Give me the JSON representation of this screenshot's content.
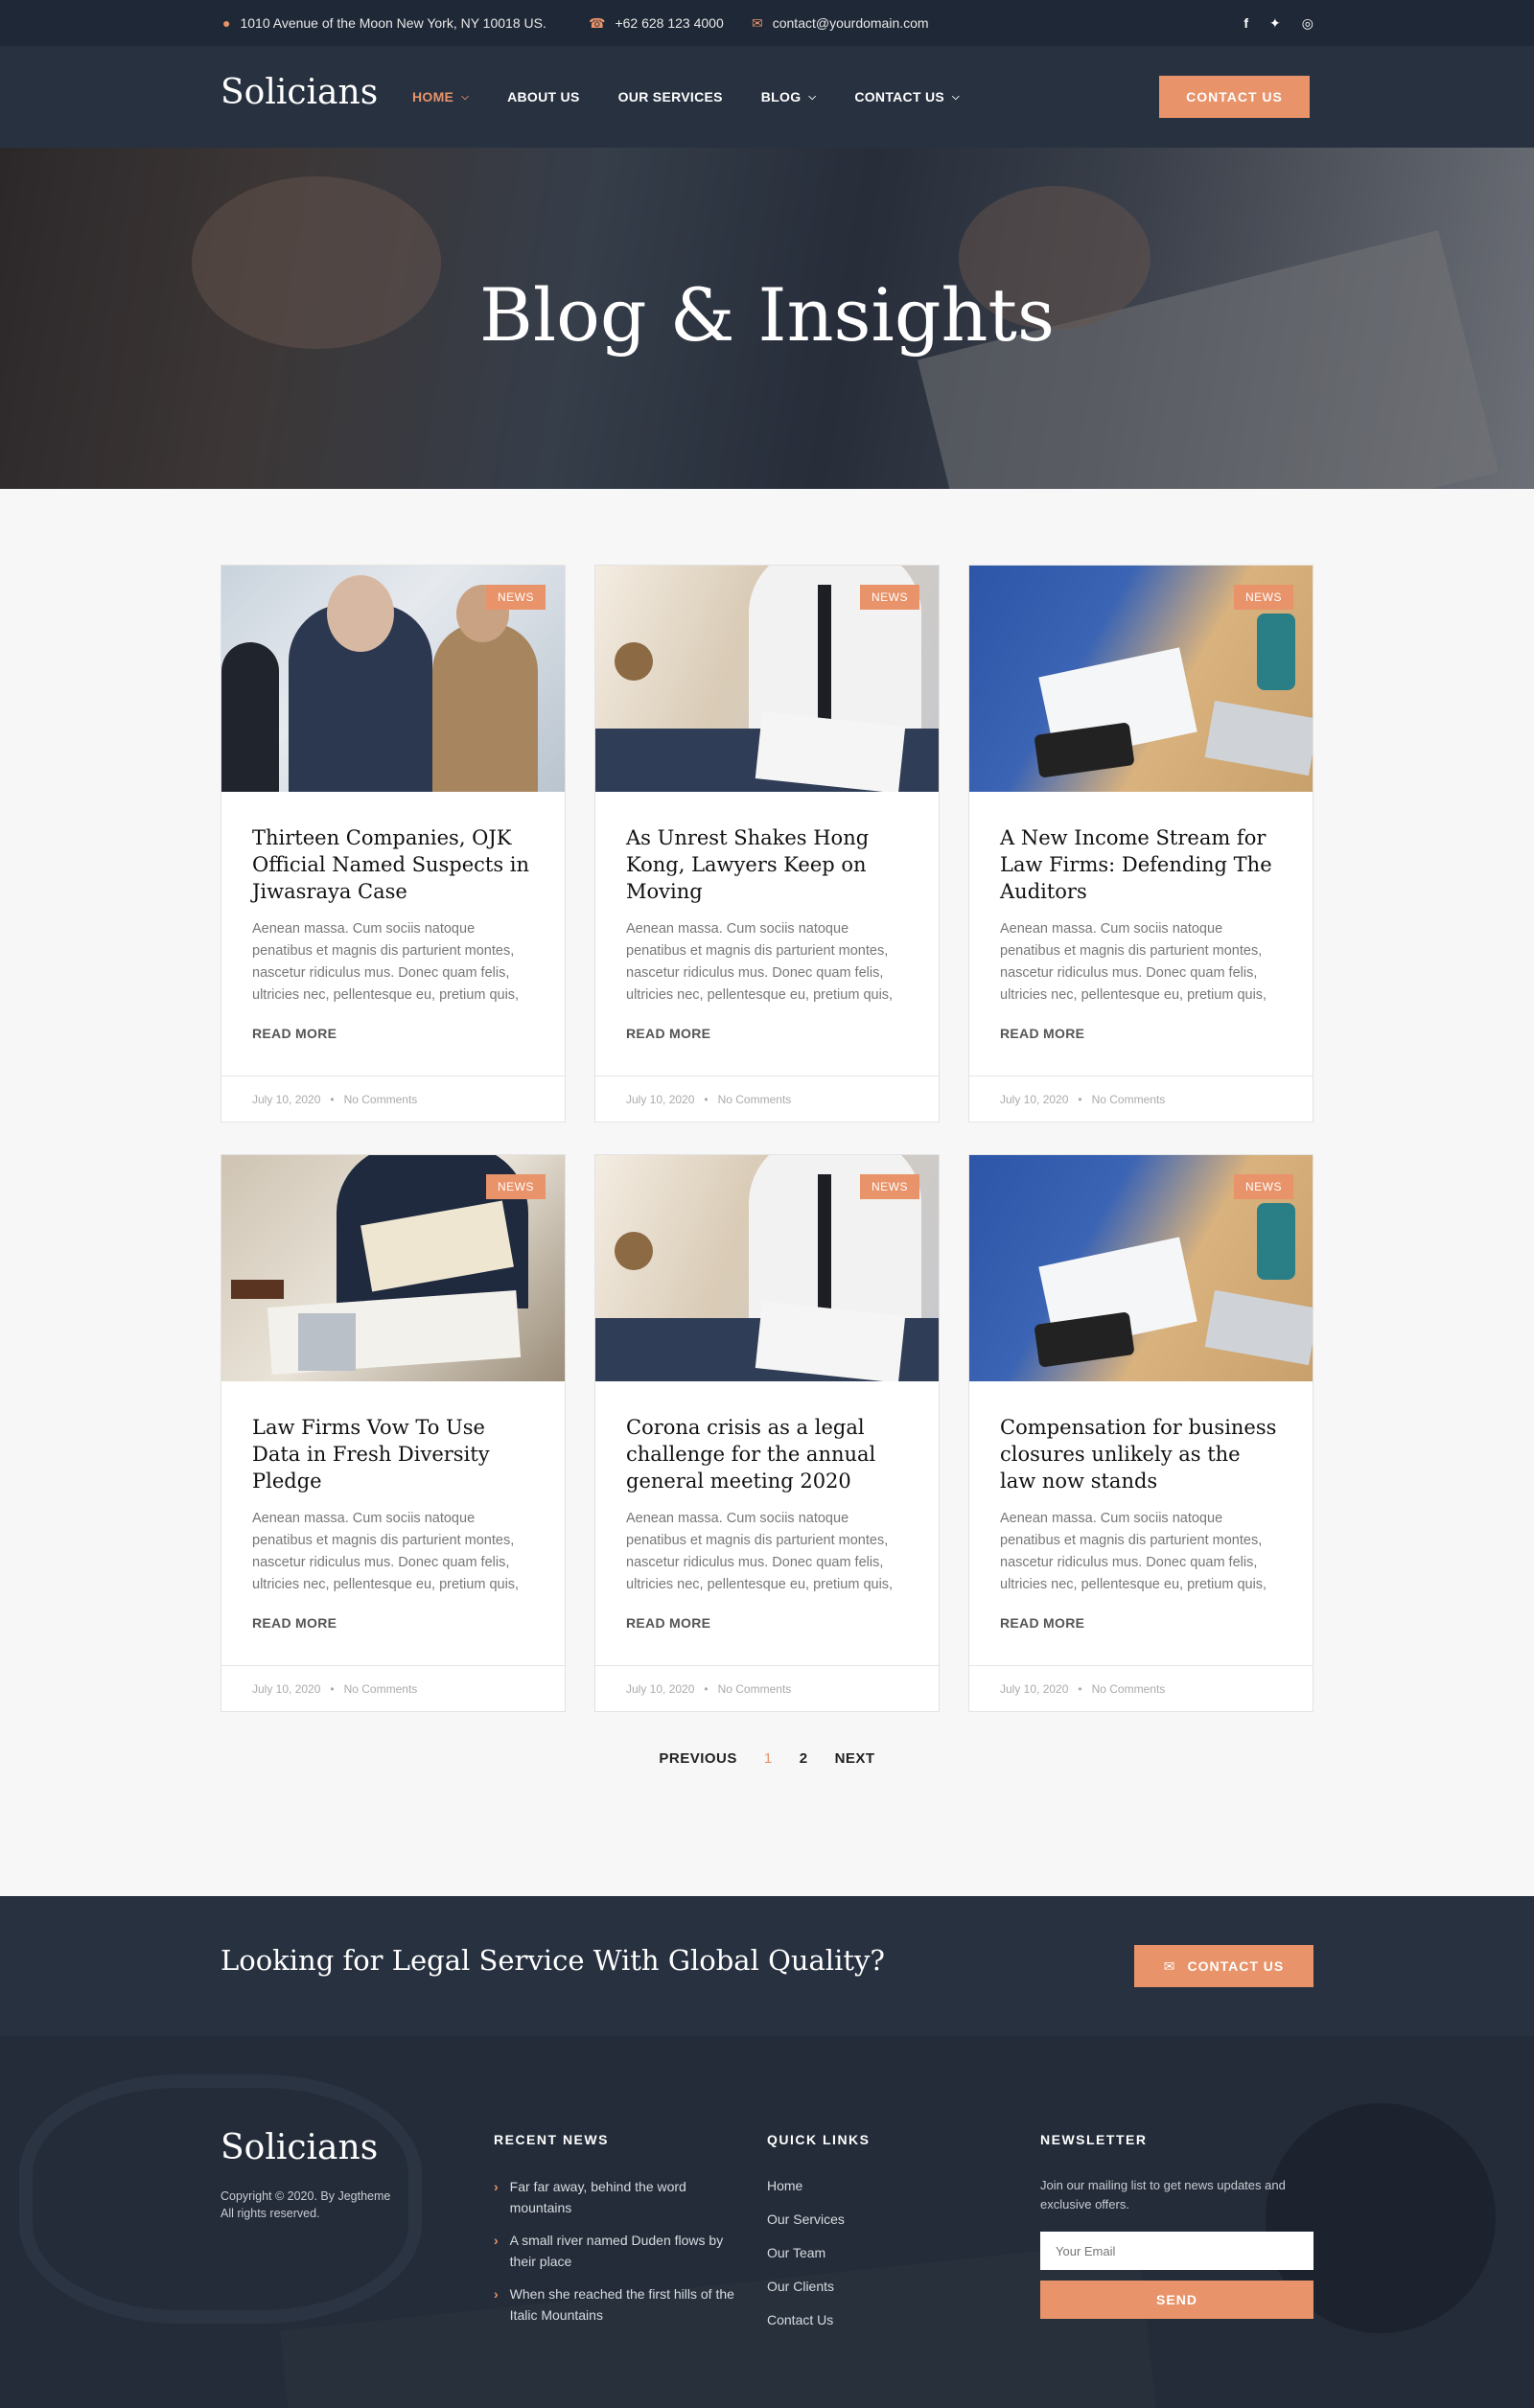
{
  "topbar": {
    "address": "1010 Avenue of the Moon New York, NY 10018 US.",
    "phone": "+62 628 123 4000",
    "email": "contact@yourdomain.com",
    "address_icon": "map-pin-icon",
    "phone_icon": "phone-icon",
    "email_icon": "envelope-icon",
    "socials": [
      "facebook-icon",
      "twitter-icon",
      "instagram-icon"
    ]
  },
  "nav": {
    "logo": "Solicians",
    "items": [
      {
        "label": "HOME",
        "dropdown": true,
        "active": true
      },
      {
        "label": "ABOUT US",
        "dropdown": false
      },
      {
        "label": "OUR SERVICES",
        "dropdown": false
      },
      {
        "label": "BLOG",
        "dropdown": true
      },
      {
        "label": "CONTACT US",
        "dropdown": true
      }
    ],
    "cta": "CONTACT US"
  },
  "hero": {
    "title": "Blog & Insights"
  },
  "posts": [
    {
      "badge": "NEWS",
      "title": "Thirteen Companies, OJK Official Named Suspects in Jiwasraya Case",
      "excerpt": "Aenean massa. Cum sociis natoque penatibus et magnis dis parturient montes, nascetur ridiculus mus. Donec quam felis, ultricies nec, pellentesque eu, pretium quis,",
      "more": "READ MORE",
      "date": "July 10, 2020",
      "dot": "•",
      "comments": "No Comments"
    },
    {
      "badge": "NEWS",
      "title": "As Unrest Shakes Hong Kong, Lawyers Keep on Moving",
      "excerpt": "Aenean massa. Cum sociis natoque penatibus et magnis dis parturient montes, nascetur ridiculus mus. Donec quam felis, ultricies nec, pellentesque eu, pretium quis,",
      "more": "READ MORE",
      "date": "July 10, 2020",
      "dot": "•",
      "comments": "No Comments"
    },
    {
      "badge": "NEWS",
      "title": "A New Income Stream for Law Firms: Defending The Auditors",
      "excerpt": "Aenean massa. Cum sociis natoque penatibus et magnis dis parturient montes, nascetur ridiculus mus. Donec quam felis, ultricies nec, pellentesque eu, pretium quis,",
      "more": "READ MORE",
      "date": "July 10, 2020",
      "dot": "•",
      "comments": "No Comments"
    },
    {
      "badge": "NEWS",
      "title": "Law Firms Vow To Use Data in Fresh Diversity Pledge",
      "excerpt": "Aenean massa. Cum sociis natoque penatibus et magnis dis parturient montes, nascetur ridiculus mus. Donec quam felis, ultricies nec, pellentesque eu, pretium quis,",
      "more": "READ MORE",
      "date": "July 10, 2020",
      "dot": "•",
      "comments": "No Comments"
    },
    {
      "badge": "NEWS",
      "title": "Corona crisis as a legal challenge for the annual general meeting 2020",
      "excerpt": "Aenean massa. Cum sociis natoque penatibus et magnis dis parturient montes, nascetur ridiculus mus. Donec quam felis, ultricies nec, pellentesque eu, pretium quis,",
      "more": "READ MORE",
      "date": "July 10, 2020",
      "dot": "•",
      "comments": "No Comments"
    },
    {
      "badge": "NEWS",
      "title": "Compensation for business closures unlikely as the law now stands",
      "excerpt": "Aenean massa. Cum sociis natoque penatibus et magnis dis parturient montes, nascetur ridiculus mus. Donec quam felis, ultricies nec, pellentesque eu, pretium quis,",
      "more": "READ MORE",
      "date": "July 10, 2020",
      "dot": "•",
      "comments": "No Comments"
    }
  ],
  "pagination": {
    "previous": "PREVIOUS",
    "pages": [
      "1",
      "2"
    ],
    "current": "1",
    "next": "NEXT"
  },
  "cta_band": {
    "heading": "Looking for Legal Service With Global Quality?",
    "button": "CONTACT US",
    "button_icon": "envelope-icon"
  },
  "footer": {
    "logo": "Solicians",
    "copyright": "Copyright © 2020. By Jegtheme",
    "rights": "All rights reserved.",
    "recent_news": {
      "title": "RECENT NEWS",
      "items": [
        "Far far away, behind the word mountains",
        "A small river named Duden flows by their place",
        "When she reached the first hills of the Italic Mountains"
      ]
    },
    "quick_links": {
      "title": "QUICK LINKS",
      "items": [
        "Home",
        "Our Services",
        "Our Team",
        "Our Clients",
        "Contact Us"
      ]
    },
    "newsletter": {
      "title": "NEWSLETTER",
      "text": "Join our mailing list to get news updates and exclusive offers.",
      "placeholder": "Your Email",
      "button": "SEND"
    }
  },
  "colors": {
    "accent": "#e8936a",
    "dark": "#273140",
    "topbar": "#1f2836"
  }
}
